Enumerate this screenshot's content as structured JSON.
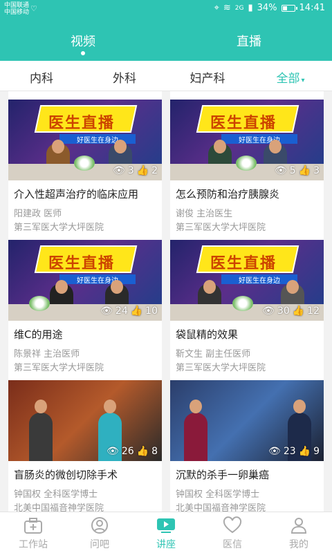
{
  "status": {
    "carrier1": "中国联通",
    "carrier2": "中国移动",
    "signal_label": "2G",
    "battery": "34%",
    "time": "14:41"
  },
  "top_tabs": [
    {
      "label": "视频",
      "active": true
    },
    {
      "label": "直播",
      "active": false
    }
  ],
  "categories": [
    {
      "label": "内科"
    },
    {
      "label": "外科"
    },
    {
      "label": "妇产科"
    },
    {
      "label": "全部",
      "active": true
    }
  ],
  "thumb_text": {
    "banner": "医生直播",
    "sub": "好医生在身边"
  },
  "videos": [
    {
      "title": "介入性超声治疗的临床应用",
      "doctor": "阳建政 医师",
      "hospital": "第三军医大学大坪医院",
      "views": "3",
      "likes": "2"
    },
    {
      "title": "怎么预防和治疗胰腺炎",
      "doctor": "谢俊 主治医生",
      "hospital": "第三军医大学大坪医院",
      "views": "5",
      "likes": "3"
    },
    {
      "title": "维C的用途",
      "doctor": "陈景祥 主治医师",
      "hospital": "第三军医大学大坪医院",
      "views": "24",
      "likes": "10"
    },
    {
      "title": "袋鼠精的效果",
      "doctor": "靳文生 副主任医师",
      "hospital": "第三军医大学大坪医院",
      "views": "30",
      "likes": "12"
    },
    {
      "title": "盲肠炎的微创切除手术",
      "doctor": "钟国权 全科医学博士",
      "hospital": "北美中国福音神学医院",
      "views": "26",
      "likes": "8"
    },
    {
      "title": "沉默的杀手一卵巢癌",
      "doctor": "钟国权 全科医学博士",
      "hospital": "北美中国福音神学医院",
      "views": "23",
      "likes": "9"
    }
  ],
  "tabbar": [
    {
      "label": "工作站",
      "icon": "medical-kit-icon"
    },
    {
      "label": "问吧",
      "icon": "doctor-icon"
    },
    {
      "label": "讲座",
      "icon": "video-play-icon",
      "active": true
    },
    {
      "label": "医信",
      "icon": "heart-icon"
    },
    {
      "label": "我的",
      "icon": "person-icon"
    }
  ],
  "colors": {
    "accent": "#2ec4b3",
    "like": "#ff5a5a"
  }
}
